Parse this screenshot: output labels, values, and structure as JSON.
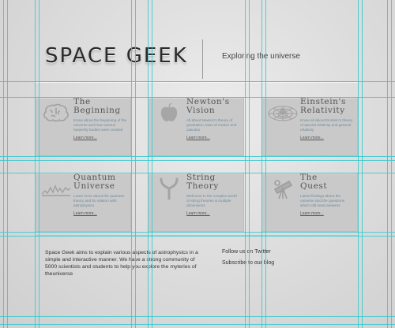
{
  "header": {
    "logo": "SPACE GEEK",
    "tagline": "Exploring the universe"
  },
  "cards": [
    {
      "icon": "brain-icon",
      "title": "The\nBeginning",
      "desc": "Know about the beginning of the universe and how various heavenly bodies were created",
      "more": "Learn more..."
    },
    {
      "icon": "apple-icon",
      "title": "Newton's\nVision",
      "desc": "All about Newton's theory of gravitation, laws of motion and calculus",
      "more": "Learn more..."
    },
    {
      "icon": "spacetime-grid-icon",
      "title": "Einstein's\nRelativity",
      "desc": "Know all about Einstein's theory of special relativity and general relativity",
      "more": "Learn more..."
    },
    {
      "icon": "wave-graph-icon",
      "title": "Quantum\nUniverse",
      "desc": "Learn more about the quantum theory and its relation with astrophysics",
      "more": "Learn more..."
    },
    {
      "icon": "string-icon",
      "title": "String\nTheory",
      "desc": "Welcome to the complex world of string theories & multiple dimensions",
      "more": "Learn more..."
    },
    {
      "icon": "telescope-icon",
      "title": "The\nQuest",
      "desc": "Latest findings about the universe and the questions which still need answers",
      "more": "Learn more..."
    }
  ],
  "footer": {
    "about": "Space Geek aims to explain various aspects of astrophysics in a simple and interactive manner. We have a strong community of 5000 scientists and students to help you explore the myteries of theuniverse",
    "follow": "Follow us on Twitter",
    "blog": "Subscribe to our blog"
  }
}
